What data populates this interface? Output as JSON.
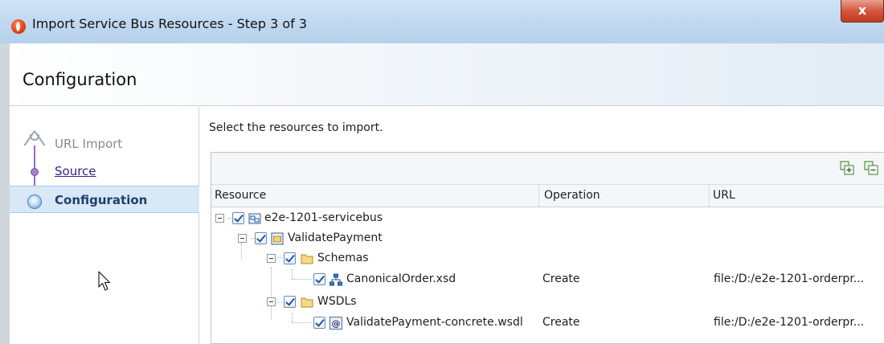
{
  "window": {
    "title": "Import Service Bus Resources - Step 3 of 3",
    "close_glyph": "x",
    "icon": "oracle-app-icon"
  },
  "header": {
    "title": "Configuration"
  },
  "steps": [
    {
      "label": "URL Import",
      "state": "disabled"
    },
    {
      "label": "Source",
      "state": "link"
    },
    {
      "label": "Configuration",
      "state": "current"
    }
  ],
  "main": {
    "instruction": "Select the resources to import.",
    "toolbar": {
      "expand_icon": "expand-all-icon",
      "collapse_icon": "collapse-all-icon"
    },
    "columns": {
      "resource": "Resource",
      "operation": "Operation",
      "url": "URL"
    },
    "rows": [
      {
        "label": "e2e-1201-servicebus",
        "operation": "",
        "url": "",
        "icon": "servicebus-project-icon",
        "checked": true
      },
      {
        "label": "ValidatePayment",
        "operation": "",
        "url": "",
        "icon": "project-folder-icon",
        "checked": true
      },
      {
        "label": "Schemas",
        "operation": "",
        "url": "",
        "icon": "folder-icon",
        "checked": true
      },
      {
        "label": "CanonicalOrder.xsd",
        "operation": "Create",
        "url": "file:/D:/e2e-1201-orderpr...",
        "icon": "schema-icon",
        "checked": true
      },
      {
        "label": "WSDLs",
        "operation": "",
        "url": "",
        "icon": "folder-icon",
        "checked": true
      },
      {
        "label": "ValidatePayment-concrete.wsdl",
        "operation": "Create",
        "url": "file:/D:/e2e-1201-orderpr...",
        "icon": "wsdl-icon",
        "checked": true
      }
    ]
  },
  "colors": {
    "titlebar": "#c2daf1",
    "selected_step": "#d9e8f7",
    "link": "#3a1d8a",
    "close_button": "#d5573c"
  }
}
